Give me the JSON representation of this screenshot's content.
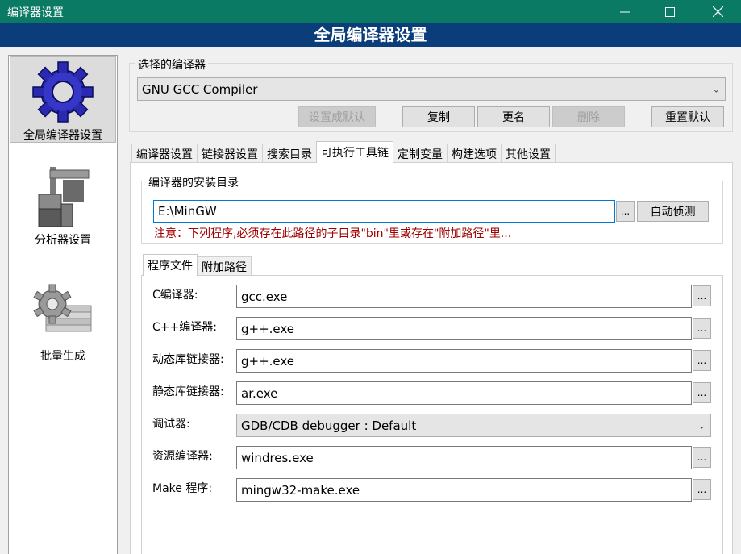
{
  "window": {
    "title": "编译器设置",
    "minimize_icon": "minimize-icon",
    "maximize_icon": "maximize-icon",
    "close_icon": "close-icon"
  },
  "banner": {
    "title": "全局编译器设置"
  },
  "sidebar": {
    "items": [
      {
        "label": "全局编译器设置",
        "icon": "gear-icon",
        "selected": true
      },
      {
        "label": "分析器设置",
        "icon": "caliper-icon",
        "selected": false
      },
      {
        "label": "批量生成",
        "icon": "batch-gear-icon",
        "selected": false
      }
    ]
  },
  "compiler_select": {
    "group_label": "选择的编译器",
    "selected": "GNU GCC Compiler",
    "buttons": {
      "set_default": "设置成默认",
      "copy": "复制",
      "rename": "更名",
      "delete": "删除",
      "reset_defaults": "重置默认"
    }
  },
  "tabs": [
    "编译器设置",
    "链接器设置",
    "搜索目录",
    "可执行工具链",
    "定制变量",
    "构建选项",
    "其他设置"
  ],
  "active_tab": "可执行工具链",
  "install_dir": {
    "group_label": "编译器的安装目录",
    "value": "E:\\MinGW",
    "browse_label": "...",
    "autodetect_label": "自动侦测",
    "note": "注意：下列程序,必须存在此路径的子目录\"bin\"里或存在\"附加路径\"里..."
  },
  "subtabs": [
    "程序文件",
    "附加路径"
  ],
  "programs": [
    {
      "label": "C编译器:",
      "value": "gcc.exe",
      "type": "text"
    },
    {
      "label": "C++编译器:",
      "value": "g++.exe",
      "type": "text"
    },
    {
      "label": "动态库链接器:",
      "value": "g++.exe",
      "type": "text"
    },
    {
      "label": "静态库链接器:",
      "value": "ar.exe",
      "type": "text"
    },
    {
      "label": "调试器:",
      "value": "GDB/CDB debugger : Default",
      "type": "select"
    },
    {
      "label": "资源编译器:",
      "value": "windres.exe",
      "type": "text"
    },
    {
      "label": "Make 程序:",
      "value": "mingw32-make.exe",
      "type": "text"
    }
  ],
  "colors": {
    "titlebar": "#0a7a64",
    "banner": "#0a3d7a",
    "warning": "#a00000"
  }
}
